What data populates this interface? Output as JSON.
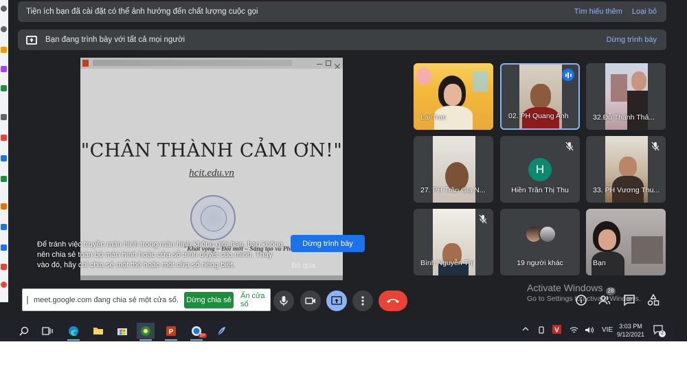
{
  "banners": {
    "extension_warning": "Tiện ích bạn đã cài đặt có thể ảnh hưởng đến chất lượng cuộc gọi",
    "learn_more": "Tìm hiểu thêm",
    "dismiss": "Loại bỏ",
    "presenting_notice": "Bạn đang trình bày với tất cả mọi người",
    "stop_presenting_link": "Dừng trình bày"
  },
  "slide": {
    "title": "\"CHÂN THÀNH CẢM ƠN!\"",
    "url": "hcit.edu.vn",
    "motto": "\"Khát vọng – Đổi mới – Sáng tạo và Phát triển\""
  },
  "warning": {
    "text": "Để tránh việc truyền màn hình trong màn hình không giới hạn, bạn không nên chia sẻ toàn bộ màn hình hoặc cửa sổ trình duyệt của mình. Thay vào đó, hãy chỉ chia sẻ một thẻ hoặc một cửa sổ riêng biệt.",
    "stop_button": "Dừng trình bày",
    "skip_button": "Bỏ qua"
  },
  "participants": [
    {
      "name": "Lai Tran"
    },
    {
      "name": "02. PH Quang Anh"
    },
    {
      "name": "32.Đỗ Thanh Thả..."
    },
    {
      "name": "27. PH Trần Gia N..."
    },
    {
      "name": "Hiền Trần Thị Thu",
      "initial": "H"
    },
    {
      "name": "33. PH Vương Thu..."
    },
    {
      "name": "Bình Nguyễn Thị"
    },
    {
      "name": "19 người khác"
    },
    {
      "name": "Bạn"
    }
  ],
  "share_bar": {
    "message": "meet.google.com đang chia sẻ một cửa sổ.",
    "stop_button": "Dừng chia sẻ",
    "hide_button": "Ẩn cửa sổ"
  },
  "windows_watermark": {
    "title": "Activate Windows",
    "subtitle": "Go to Settings to activate Windows."
  },
  "people_count": "28",
  "taskbar": {
    "language": "VIE",
    "time": "3:03 PM",
    "date": "9/12/2021",
    "notification_count": "2",
    "badge_count": "5+"
  },
  "icons": {
    "hangup": "phone-hangup-icon",
    "mic": "mic-icon",
    "camera": "camera-icon",
    "present": "present-icon",
    "more": "more-vert-icon",
    "info": "info-icon",
    "people": "people-icon",
    "chat": "chat-icon",
    "activities": "activities-icon"
  },
  "colors": {
    "accent": "#1a73e8",
    "hangup": "#ea4335",
    "share_green": "#1e8e3e",
    "avatar_h": "#0b8a6f"
  }
}
